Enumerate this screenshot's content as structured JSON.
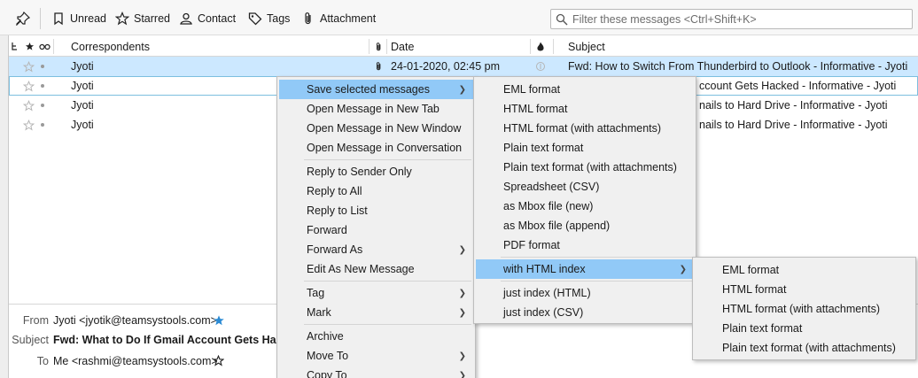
{
  "toolbar": {
    "unread": "Unread",
    "starred": "Starred",
    "contact": "Contact",
    "tags": "Tags",
    "attachment": "Attachment",
    "filter_placeholder": "Filter these messages <Ctrl+Shift+K>"
  },
  "columns": {
    "correspondents": "Correspondents",
    "date": "Date",
    "subject": "Subject"
  },
  "rows": [
    {
      "from": "Jyoti",
      "date": "24-01-2020, 02:45 pm",
      "subject": "Fwd: How to Switch From Thunderbird to Outlook - Informative - Jyoti"
    },
    {
      "from": "Jyoti",
      "date": "",
      "subject": "ccount Gets Hacked - Informative - Jyoti"
    },
    {
      "from": "Jyoti",
      "date": "",
      "subject": "nails to Hard Drive - Informative - Jyoti"
    },
    {
      "from": "Jyoti",
      "date": "",
      "subject": "nails to Hard Drive - Informative - Jyoti"
    }
  ],
  "header_pane": {
    "from_label": "From",
    "from_value": "Jyoti <jyotik@teamsystools.com>",
    "subject_label": "Subject",
    "subject_value": "Fwd: What to Do If Gmail Account Gets Hacke",
    "to_label": "To",
    "to_value": "Me <rashmi@teamsystools.com>"
  },
  "context_menu": {
    "save_selected": "Save selected messages",
    "open_new_tab": "Open Message in New Tab",
    "open_new_window": "Open Message in New Window",
    "open_conversation": "Open Message in Conversation",
    "reply_sender": "Reply to Sender Only",
    "reply_all": "Reply to All",
    "reply_list": "Reply to List",
    "forward": "Forward",
    "forward_as": "Forward As",
    "edit_as_new": "Edit As New Message",
    "tag": "Tag",
    "mark": "Mark",
    "archive": "Archive",
    "move_to": "Move To",
    "copy_to": "Copy To"
  },
  "save_submenu": {
    "eml": "EML format",
    "html": "HTML format",
    "html_att": "HTML format (with attachments)",
    "plain": "Plain text format",
    "plain_att": "Plain text format (with attachments)",
    "csv": "Spreadsheet (CSV)",
    "mbox_new": "as Mbox file (new)",
    "mbox_append": "as Mbox file (append)",
    "pdf": "PDF format",
    "html_index": "with HTML index",
    "index_html": "just index (HTML)",
    "index_csv": "just index (CSV)"
  },
  "index_submenu": {
    "eml": "EML format",
    "html": "HTML format",
    "html_att": "HTML format (with attachments)",
    "plain": "Plain text format",
    "plain_att": "Plain text format (with attachments)"
  },
  "colors": {
    "selection": "#cce8ff",
    "menu_highlight": "#91c9f7",
    "star_blue": "#2a8ad4"
  }
}
